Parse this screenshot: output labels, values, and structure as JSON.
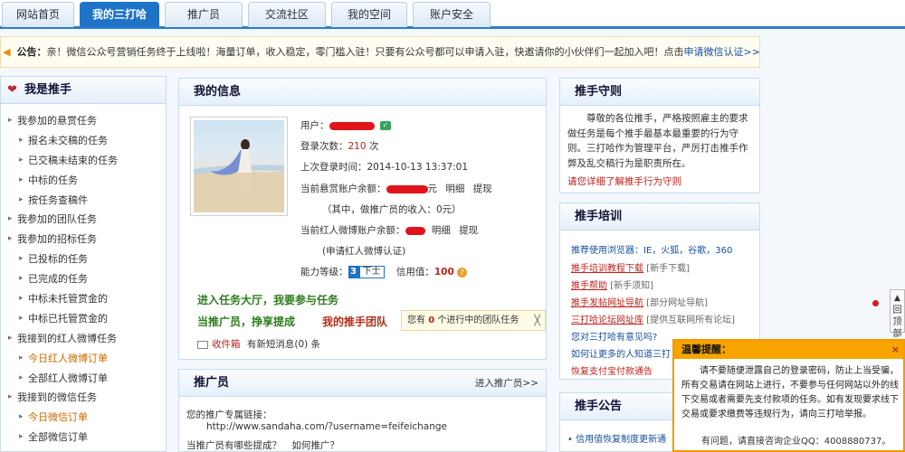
{
  "nav": {
    "tabs": [
      {
        "label": "网站首页"
      },
      {
        "label": "我的三打哈"
      },
      {
        "label": "推广员"
      },
      {
        "label": "交流社区"
      },
      {
        "label": "我的空间"
      },
      {
        "label": "账户安全"
      }
    ]
  },
  "announcement": {
    "label": "公告：",
    "text": "亲！微信公众号营销任务终于上线啦！海量订单，收入稳定，零门槛入驻！只要有公众号都可以申请入驻，快邀请你的小伙伴们一起加入吧！点击",
    "link": "申请微信认证>>"
  },
  "sidebar": {
    "title": "我是推手",
    "items": [
      {
        "label": "我参加的悬赏任务"
      },
      {
        "label": "报名未交稿的任务"
      },
      {
        "label": "已交稿未结束的任务"
      },
      {
        "label": "中标的任务"
      },
      {
        "label": "按任务查稿件"
      },
      {
        "label": "我参加的团队任务"
      },
      {
        "label": "我参加的招标任务"
      },
      {
        "label": "已投标的任务"
      },
      {
        "label": "已完成的任务"
      },
      {
        "label": "中标未托管赏金的"
      },
      {
        "label": "中标已托管赏金的"
      },
      {
        "label": "我接到的红人微博任务"
      },
      {
        "label": "今日红人微博订单"
      },
      {
        "label": "全部红人微博订单"
      },
      {
        "label": "我接到的微信任务"
      },
      {
        "label": "今日微信订单"
      },
      {
        "label": "全部微信订单"
      }
    ]
  },
  "info": {
    "title": "我的信息",
    "user_label": "用户：",
    "login_count_label": "登录次数：",
    "login_count": "210",
    "login_count_unit": "次",
    "last_login_label": "上次登录时间：",
    "last_login": "2014-10-13 13:37:01",
    "bounty_label": "当前悬赏账户余额：",
    "bounty_suffix": "元",
    "detail": "明细",
    "withdraw": "提现",
    "promoter_income": "（其中，做推广员的收入：0元）",
    "weibo_label": "当前红人微博账户余额：",
    "weibo_apply": "(申请红人微博认证)",
    "level_label": "能力等级：",
    "level_value": "3",
    "level_name": "下士",
    "credit_label": "信用值：",
    "credit_value": "100",
    "enter_hall": "进入任务大厅，我要参与任务",
    "be_promoter": "当推广员，挣享提成",
    "my_team": "我的推手团队",
    "team_tip_pre": "您有",
    "team_tip_count": "0",
    "team_tip_post": "个进行中的团队任务",
    "team_tip_close": "╳",
    "inbox_label": "收件箱",
    "inbox_text": "有新短消息(0) 条"
  },
  "promoter": {
    "title": "推广员",
    "more": "进入推广员>>",
    "link_label": "您的推广专属链接：",
    "link_url": "http://www.sandaha.com/?username=feifeichange",
    "question": "当推广员有哪些提成？",
    "how": "如何推广？"
  },
  "guide": {
    "title": "推手守则",
    "body": "尊敬的各位推手，严格按照雇主的要求做任务是每个推手最基本最重要的行为守则。三打哈作为管理平台，严厉打击推手作弊及乱交稿行为是职责所在。",
    "link": "请您详细了解推手行为守则"
  },
  "training": {
    "title": "推手培训",
    "items": [
      {
        "text": "推荐使用浏览器：IE，火狐，谷歌，360"
      },
      {
        "text": "推手培训教程下载",
        "tag": "[新手下载]"
      },
      {
        "text": "推手帮助",
        "tag": "[新手须知]"
      },
      {
        "text": "推手发帖网址导航",
        "tag": "[部分网址导航]"
      },
      {
        "text": "三打哈论坛网址库",
        "tag": "[提供互联网所有论坛]"
      },
      {
        "text": "您对三打哈有意见吗?"
      },
      {
        "text": "如何让更多的人知道三打"
      },
      {
        "text": "恢复支付宝付款通告"
      }
    ]
  },
  "notice": {
    "title": "推手公告",
    "line": "信用值恢复制度更新通"
  },
  "back_top": {
    "label": "回顶部"
  },
  "reminder": {
    "title": "温馨提醒：",
    "close": "×",
    "body": "请不要随便泄露自己的登录密码，防止上当受骗，所有交易请在网站上进行，不要参与任何网站以外的线下交易或者需要先支付款项的任务。如有发现要求线下交易或要求缴费等违规行为，请向三打哈举报。",
    "contact": "有问题，请直接咨询企业QQ：4008880737。"
  }
}
